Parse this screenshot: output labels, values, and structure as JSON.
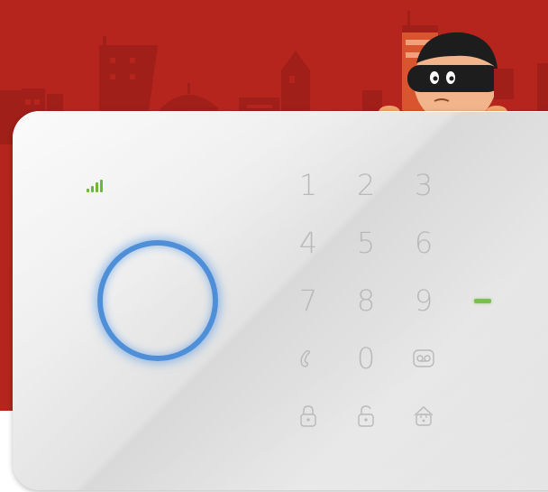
{
  "keypad": {
    "keys": [
      {
        "label": "1"
      },
      {
        "label": "2"
      },
      {
        "label": "3"
      },
      {
        "label": "4"
      },
      {
        "label": "5"
      },
      {
        "label": "6"
      },
      {
        "label": "7"
      },
      {
        "label": "8"
      },
      {
        "label": "9"
      },
      {
        "icon": "phone-icon"
      },
      {
        "label": "0"
      },
      {
        "icon": "voicemail-icon"
      },
      {
        "icon": "lock-icon"
      },
      {
        "icon": "unlock-icon"
      },
      {
        "icon": "home-lock-icon"
      }
    ]
  },
  "indicators": {
    "signal_bars": 4,
    "signal_color": "#6db83a",
    "status_led_color": "#7ac143",
    "ring_color": "#4f8fd8"
  },
  "colors": {
    "background": "#b5251d",
    "device": "#e6e6e6"
  }
}
